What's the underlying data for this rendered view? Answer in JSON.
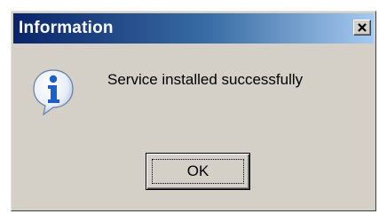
{
  "dialog": {
    "title": "Information",
    "message": "Service installed successfully",
    "ok_label": "OK",
    "icon": "info-icon",
    "close_icon": "close-icon"
  },
  "colors": {
    "titlebar_start": "#0a246a",
    "titlebar_end": "#a6caf0",
    "dialog_bg": "#d4d0c8",
    "info_icon_blue": "#1c5fc7"
  }
}
